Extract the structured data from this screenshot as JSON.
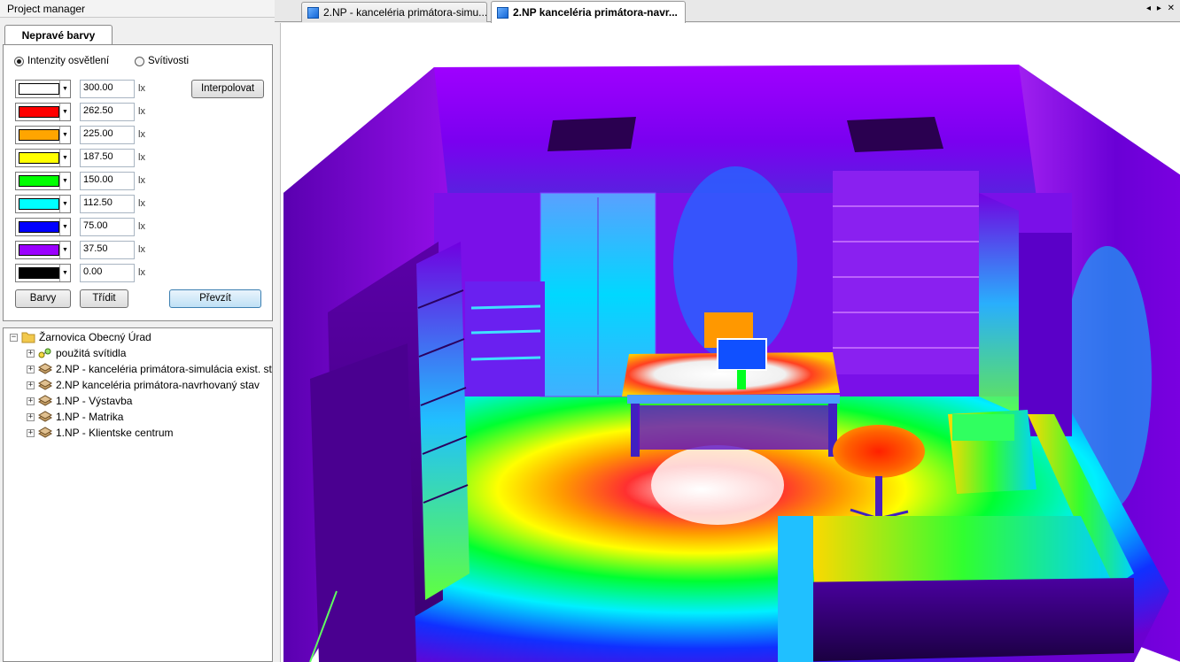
{
  "project_manager": {
    "title": "Project manager"
  },
  "color_panel": {
    "tab_label": "Nepravé barvy",
    "radio_illuminance": "Intenzity osvětlení",
    "radio_luminance": "Svítivosti",
    "unit": "lx",
    "rows": [
      {
        "color": "#ffffff",
        "value": "300.00"
      },
      {
        "color": "#ff0000",
        "value": "262.50"
      },
      {
        "color": "#ffa500",
        "value": "225.00"
      },
      {
        "color": "#ffff00",
        "value": "187.50"
      },
      {
        "color": "#00ff00",
        "value": "150.00"
      },
      {
        "color": "#00ffff",
        "value": "112.50"
      },
      {
        "color": "#0000ff",
        "value": "75.00"
      },
      {
        "color": "#9b00ff",
        "value": "37.50"
      },
      {
        "color": "#000000",
        "value": "0.00"
      }
    ],
    "interpolate_label": "Interpolovat",
    "colors_label": "Barvy",
    "sort_label": "Třídit",
    "apply_label": "Převzít"
  },
  "tree": {
    "root": "Žarnovica Obecný Úrad",
    "items": [
      "použitá svítidla",
      "2.NP - kanceléria primátora-simulácia exist. st",
      "2.NP kanceléria primátora-navrhovaný stav",
      "1.NP - Výstavba",
      "1.NP - Matrika",
      "1.NP - Klientske centrum"
    ]
  },
  "tabs": [
    {
      "label": "2.NP - kanceléria primátora-simu..."
    },
    {
      "label": "2.NP kanceléria primátora-navr..."
    }
  ],
  "tab_nav": "◂ ▸ ✕"
}
